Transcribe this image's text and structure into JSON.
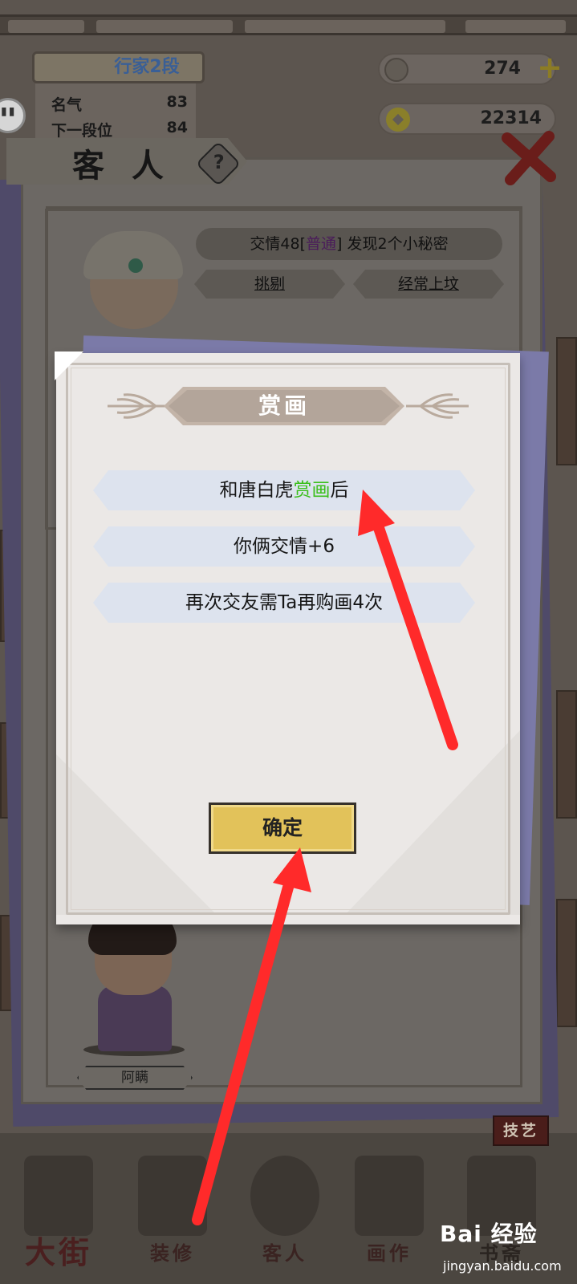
{
  "header": {
    "rank_label": "行家2段",
    "fame_label": "名气",
    "fame_value": "83",
    "next_rank_label": "下一段位",
    "next_rank_value": "84",
    "jade_amount": "274",
    "coin_amount": "22314"
  },
  "guest_panel": {
    "title": "客 人",
    "help_symbol": "?",
    "guest1": {
      "info_prefix": "交情48[",
      "info_rarity": "普通",
      "info_suffix": "] 发现2个小秘密",
      "trait_1": "挑剔",
      "trait_2": "经常上坟"
    },
    "guest2": {
      "name": "阿瞒"
    }
  },
  "bottom_nav": {
    "items": [
      {
        "label": "大街"
      },
      {
        "label": "装修"
      },
      {
        "label": "客人"
      },
      {
        "label": "画作"
      },
      {
        "label": "书斋"
      }
    ],
    "skill_label": "技艺"
  },
  "modal": {
    "title": "赏画",
    "line1_prefix": "和唐白虎",
    "line1_highlight": "赏画",
    "line1_suffix": "后",
    "line2": "你俩交情+6",
    "line3": "再次交友需Ta再购画4次",
    "confirm_label": "确定"
  },
  "colors": {
    "highlight_green": "#3bbf1b",
    "rarity_purple": "#7a2c9a",
    "confirm_gold": "#e2c25a",
    "arrow_red": "#ff2a2a"
  },
  "icons": [
    "jade-icon",
    "plus-icon",
    "coin-icon",
    "help-icon",
    "close-icon",
    "chat-bubble-icon"
  ],
  "watermark": {
    "brand": "Bai 经验",
    "url": "jingyan.baidu.com"
  }
}
